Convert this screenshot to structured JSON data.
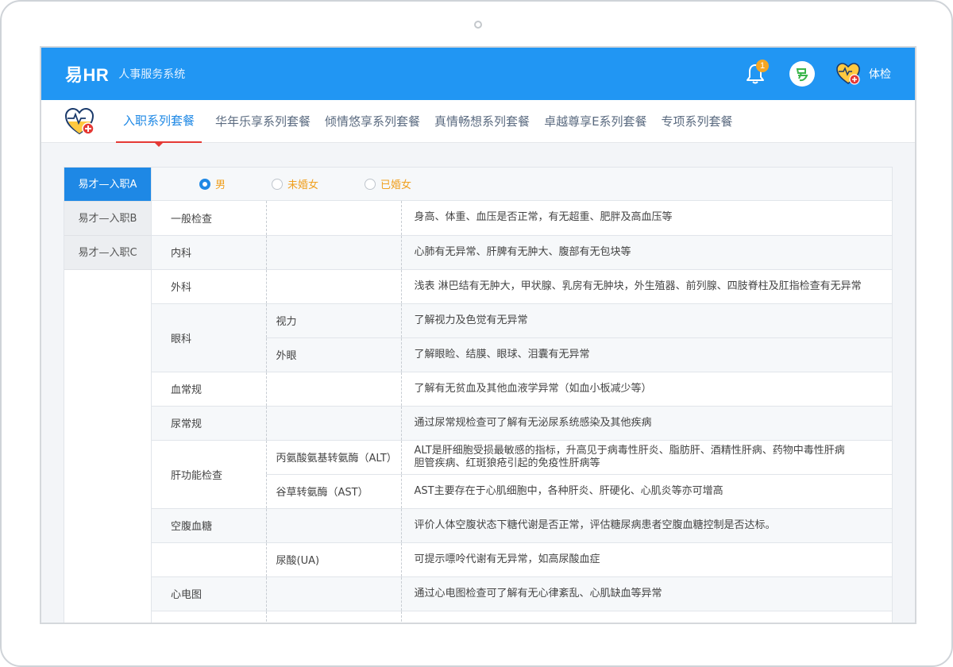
{
  "header": {
    "brand": "易HR",
    "subtitle": "人事服务系统",
    "notification_count": "1",
    "checkup_label": "体检"
  },
  "tabs": [
    {
      "label": "入职系列套餐",
      "active": true
    },
    {
      "label": "华年乐享系列套餐",
      "active": false
    },
    {
      "label": "倾情悠享系列套餐",
      "active": false
    },
    {
      "label": "真情畅想系列套餐",
      "active": false
    },
    {
      "label": "卓越尊享E系列套餐",
      "active": false
    },
    {
      "label": "专项系列套餐",
      "active": false
    }
  ],
  "packages": [
    {
      "label": "易才—入职A",
      "active": true
    },
    {
      "label": "易才—入职B",
      "active": false
    },
    {
      "label": "易才—入职C",
      "active": false
    }
  ],
  "gender_options": [
    {
      "label": "男",
      "checked": true
    },
    {
      "label": "未婚女",
      "checked": false
    },
    {
      "label": "已婚女",
      "checked": false
    }
  ],
  "items": {
    "general": {
      "name": "一般检查",
      "desc": "身高、体重、血压是否正常，有无超重、肥胖及高血压等"
    },
    "internal": {
      "name": "内科",
      "desc": "心肺有无异常、肝脾有无肿大、腹部有无包块等"
    },
    "surgery": {
      "name": "外科",
      "desc": "浅表 淋巴结有无肿大，甲状腺、乳房有无肿块，外生殖器、前列腺、四肢脊柱及肛指检查有无异常"
    },
    "eye": {
      "name": "眼科",
      "vision": "视力",
      "vision_desc": "了解视力及色觉有无异常",
      "outer": "外眼",
      "outer_desc": "了解眼睑、结膜、眼球、泪囊有无异常"
    },
    "blood": {
      "name": "血常规",
      "desc": "了解有无贫血及其他血液学异常（如血小板减少等）"
    },
    "urine": {
      "name": "尿常规",
      "desc": "通过尿常规检查可了解有无泌尿系统感染及其他疾病"
    },
    "liver": {
      "name": "肝功能检查",
      "alt": "丙氨酸氨基转氨酶（ALT）",
      "alt_desc_1": "ALT是肝细胞受损最敏感的指标，升高见于病毒性肝炎、脂肪肝、酒精性肝病、药物中毒性肝病",
      "alt_desc_2": "胆管疾病、红斑狼疮引起的免疫性肝病等",
      "ast": "谷草转氨酶（AST）",
      "ast_desc": "AST主要存在于心肌细胞中，各种肝炎、肝硬化、心肌炎等亦可增高"
    },
    "glucose": {
      "name": "空腹血糖",
      "desc": "评价人体空腹状态下糖代谢是否正常，评估糖尿病患者空腹血糖控制是否达标。"
    },
    "uric": {
      "name": "尿酸(UA)",
      "desc": "可提示嘌呤代谢有无异常，如高尿酸血症"
    },
    "ecg": {
      "name": "心电图",
      "desc": "通过心电图检查可了解有无心律紊乱、心肌缺血等异常"
    }
  },
  "colors": {
    "primary": "#2196f3",
    "active_tab_underline": "#e53935",
    "radio_label": "#f0a020",
    "badge": "#f5a623"
  }
}
